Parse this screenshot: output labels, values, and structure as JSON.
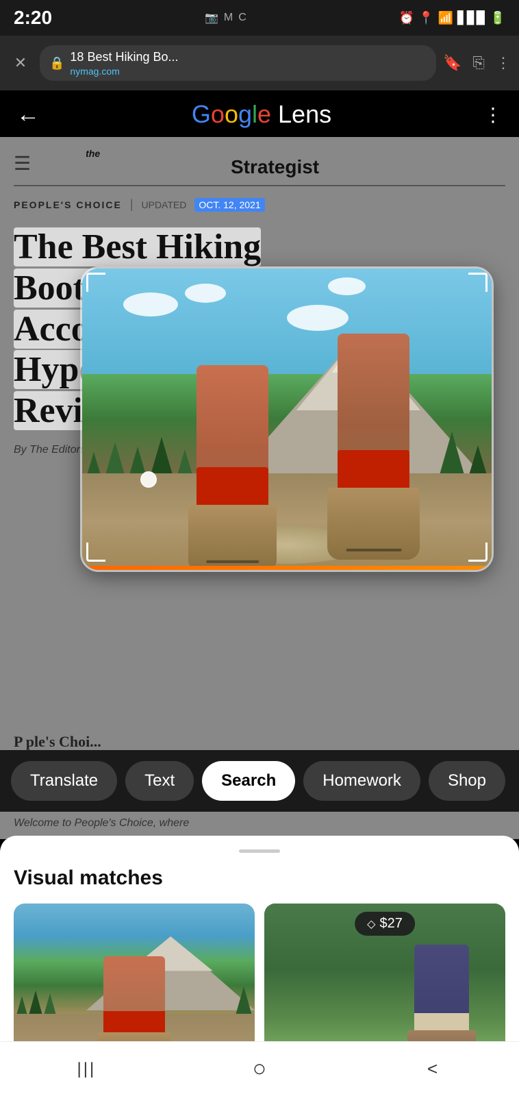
{
  "statusBar": {
    "time": "2:20",
    "leftIcons": [
      "📷",
      "M",
      "C"
    ],
    "rightIcons": [
      "🔔",
      "📍",
      "wifi",
      "signal",
      "🔋"
    ]
  },
  "browserBar": {
    "title": "18 Best Hiking Bo...",
    "domain": "nymag.com",
    "closeLabel": "✕",
    "bookmarkIcon": "🔖",
    "shareIcon": "↗",
    "moreIcon": "⋮"
  },
  "lensHeader": {
    "backIcon": "←",
    "title": "Google Lens",
    "moreIcon": "⋮"
  },
  "article": {
    "badge": "PEOPLE'S CHOICE",
    "updated": "UPDATED",
    "date": "OCT. 12, 2021",
    "title": "The Best Hiking Boots for Men, According to Hyperenthusiastic Reviewers",
    "author": "By The Editors",
    "bottomText": "P  ple's Choi..."
  },
  "tabs": [
    {
      "label": "Translate",
      "active": false
    },
    {
      "label": "Text",
      "active": false
    },
    {
      "label": "Search",
      "active": true
    },
    {
      "label": "Homework",
      "active": false
    },
    {
      "label": "Shop",
      "active": false
    }
  ],
  "welcomeText": "Welcome to People's Choice, where",
  "visualMatches": {
    "title": "Visual matches",
    "card2": {
      "price": "$27",
      "priceIcon": "◇"
    }
  },
  "navBar": {
    "menuIcon": "|||",
    "homeIcon": "○",
    "backIcon": "<"
  }
}
